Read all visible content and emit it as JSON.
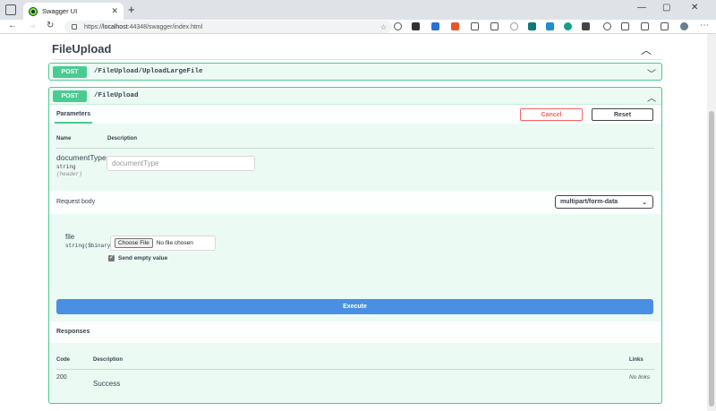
{
  "browser": {
    "tab_title": "Swagger UI",
    "tab_close": "✕",
    "new_tab": "+",
    "url_prefix": "https://",
    "url_host": "localhost",
    "url_rest": ":44348/swagger/index.html",
    "window_controls": [
      "—",
      "▢",
      "✕"
    ]
  },
  "section": {
    "title": "FileUpload",
    "chevron": "︿"
  },
  "operations": [
    {
      "method": "POST",
      "path": "/FileUpload/UploadLargeFile",
      "expanded": false
    },
    {
      "method": "POST",
      "path": "/FileUpload",
      "expanded": true
    }
  ],
  "parameters": {
    "tab_label": "Parameters",
    "cancel_label": "Cancel",
    "reset_label": "Reset",
    "col_name": "Name",
    "col_description": "Description",
    "param": {
      "name": "documentType",
      "type": "string",
      "in": "(header)",
      "placeholder": "documentType"
    }
  },
  "request_body": {
    "label": "Request body",
    "content_type": "multipart/form-data",
    "field_name": "file",
    "field_type": "string($binary)",
    "choose_file": "Choose File",
    "no_file": "No file chosen",
    "send_empty_label": "Send empty value",
    "send_empty_checked": true
  },
  "execute_label": "Execute",
  "responses": {
    "title": "Responses",
    "col_code": "Code",
    "col_description": "Description",
    "col_links": "Links",
    "rows": [
      {
        "code": "200",
        "description": "Success",
        "links": "No links"
      }
    ]
  },
  "colors": {
    "post_green": "#49cc90",
    "execute_blue": "#4990e2",
    "cancel_red": "#ff6060"
  }
}
